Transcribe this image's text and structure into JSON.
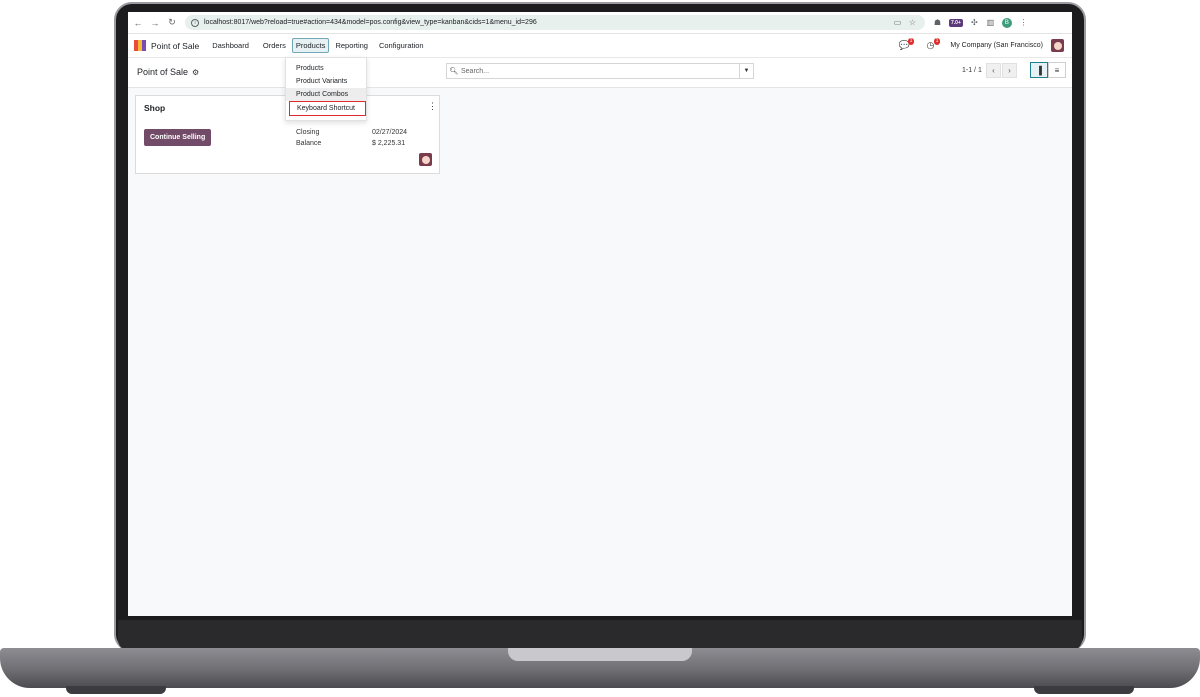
{
  "browser": {
    "url": "localhost:8017/web?reload=true#action=434&model=pos.config&view_type=kanban&cids=1&menu_id=296",
    "extension_badge": "7.0+",
    "profile_initial": "B"
  },
  "navbar": {
    "app_name": "Point of Sale",
    "menu": [
      "Dashboard",
      "Orders",
      "Products",
      "Reporting",
      "Configuration"
    ],
    "active_menu": "Products",
    "messages_badge": "1",
    "activity_badge": "1",
    "company": "My Company (San Francisco)"
  },
  "control_panel": {
    "breadcrumb": "Point of Sale",
    "search_placeholder": "Search...",
    "pager": "1-1 / 1"
  },
  "dropdown": {
    "items": [
      "Products",
      "Product Variants",
      "Product Combos",
      "Keyboard Shortcut"
    ]
  },
  "card": {
    "title": "Shop",
    "button": "Continue Selling",
    "closing_label": "Closing",
    "closing_value": "02/27/2024",
    "balance_label": "Balance",
    "balance_value": "$ 2,225.31"
  },
  "colors": {
    "brand_primary": "#714b67",
    "highlight_border": "#e02b2b",
    "active_view": "#1f7e8f"
  }
}
